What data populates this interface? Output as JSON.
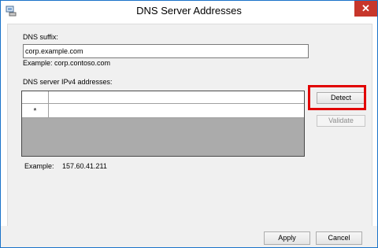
{
  "window": {
    "title": "DNS Server Addresses",
    "close_glyph": "✕"
  },
  "suffix": {
    "label": "DNS suffix:",
    "value": "corp.example.com",
    "example": "Example: corp.contoso.com"
  },
  "servers": {
    "label": "DNS server IPv4 addresses:",
    "rows": [
      {
        "marker": "",
        "value": ""
      },
      {
        "marker": "*",
        "value": ""
      }
    ],
    "example_label": "Example:",
    "example_value": "157.60.41.211"
  },
  "buttons": {
    "detect": "Detect",
    "validate": "Validate",
    "apply": "Apply",
    "cancel": "Cancel"
  },
  "colors": {
    "highlight": "#e10000",
    "close_button": "#c7362b"
  }
}
